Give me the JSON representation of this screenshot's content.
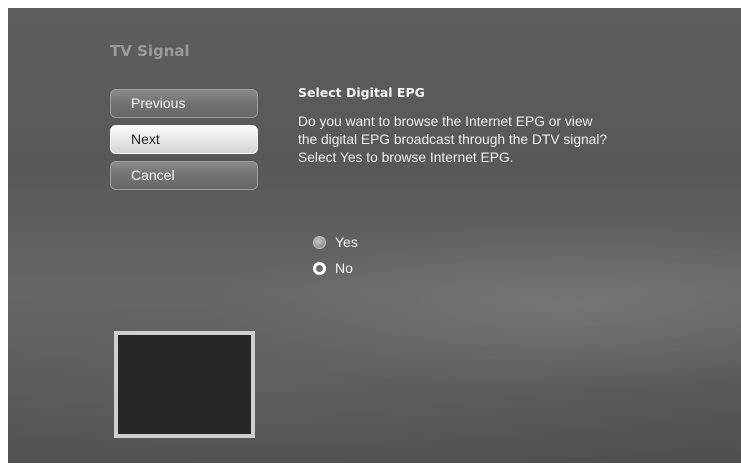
{
  "page": {
    "title": "TV Signal"
  },
  "nav_buttons": {
    "previous_label": "Previous",
    "next_label": "Next",
    "cancel_label": "Cancel",
    "focused": "Next"
  },
  "content": {
    "heading": "Select Digital EPG",
    "body_line1": "Do you want to browse the Internet EPG or view",
    "body_line2": "the digital EPG broadcast through the DTV signal?",
    "body_line3": "Select Yes to browse Internet EPG."
  },
  "options": {
    "yes_label": "Yes",
    "no_label": "No",
    "selected": "No"
  },
  "colors": {
    "background": "#5c5c5c",
    "focus_button": "#e8e8e8",
    "preview_fill": "#262626",
    "preview_border": "#cfcfcf"
  }
}
